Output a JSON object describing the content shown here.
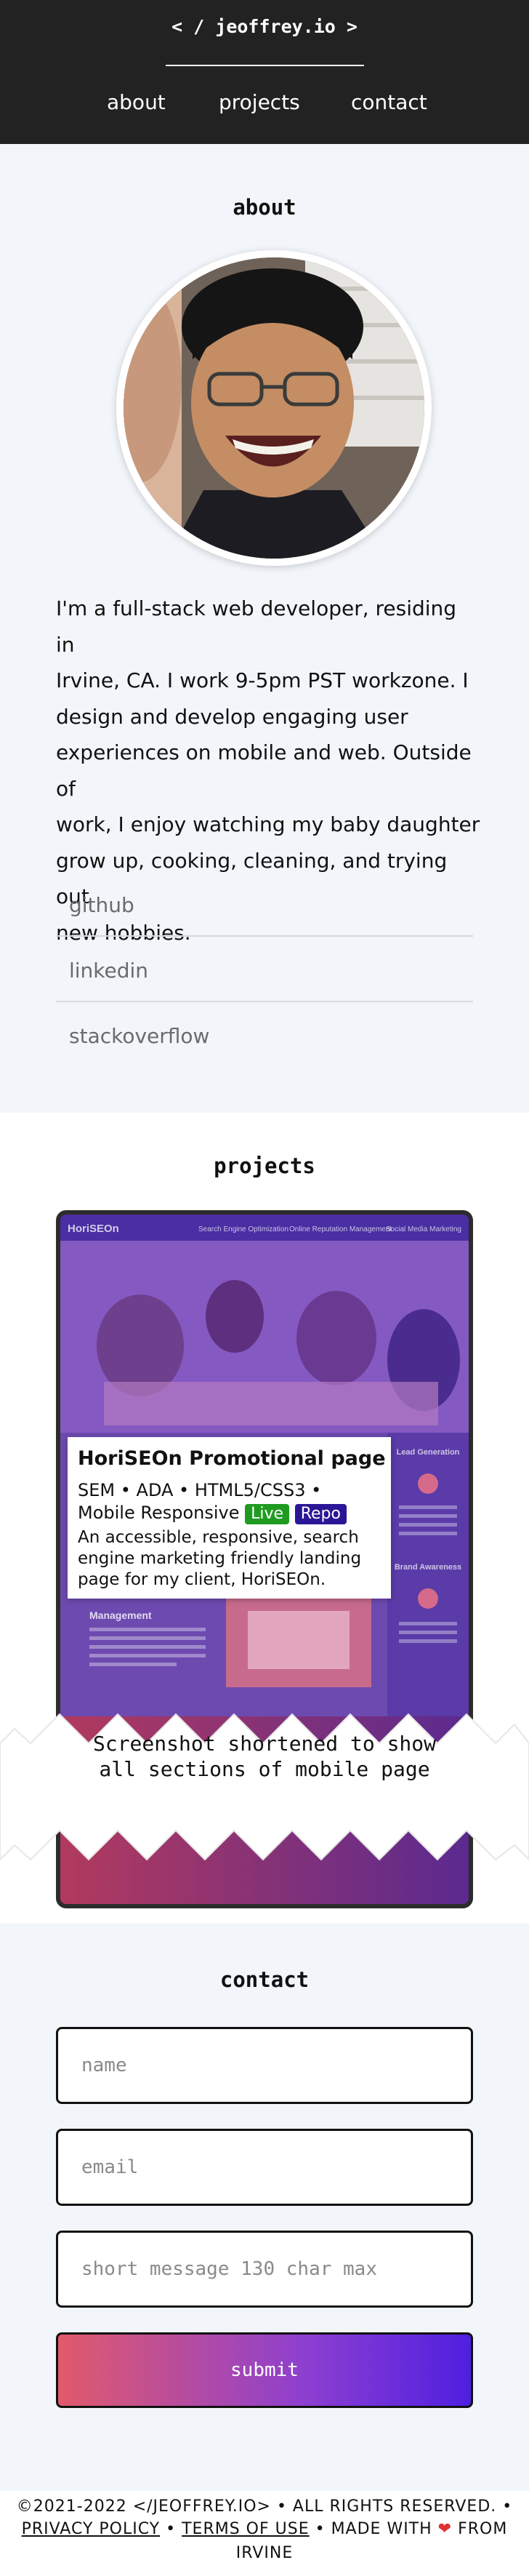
{
  "header": {
    "brand": "< / jeoffrey.io >",
    "nav": [
      {
        "label": "about"
      },
      {
        "label": "projects"
      },
      {
        "label": "contact"
      }
    ]
  },
  "about": {
    "title": "about",
    "bio_lines": [
      "I'm a full-stack web developer, residing in",
      "Irvine, CA. I work 9-5pm PST workzone. I",
      "design and develop engaging user",
      "experiences on mobile and web. Outside of",
      "work, I enjoy watching my baby daughter",
      "grow up, cooking, cleaning, and trying out",
      "new hobbies."
    ],
    "links": [
      {
        "label": "github"
      },
      {
        "label": "linkedin"
      },
      {
        "label": "stackoverflow"
      }
    ]
  },
  "projects": {
    "title": "projects",
    "mockup": {
      "brand": "HoriSEOn",
      "nav": [
        "Search Engine Optimization",
        "Online Reputation Management",
        "Social Media Marketing"
      ],
      "side_1": "Lead Generation",
      "side_2": "Brand Awareness",
      "left_heading": "Management"
    },
    "card": {
      "title": "HoriSEOn Promotional page",
      "tags": "SEM • ADA • HTML5/CSS3 • Mobile Responsive",
      "live_label": "Live",
      "repo_label": "Repo",
      "description": "An accessible, responsive, search engine marketing friendly landing page for my client, HoriSEOn."
    }
  },
  "overlay": {
    "line1": "Screenshot shortened to show",
    "line2": "all sections of mobile page"
  },
  "contact": {
    "title": "contact",
    "name_placeholder": "name",
    "email_placeholder": "email",
    "message_placeholder": "short message 130 char max",
    "submit_label": "submit"
  },
  "footer": {
    "copyright": "©2021-2022 </JEOFFREY.IO> • ALL RIGHTS RESERVED. •",
    "privacy": "PRIVACY POLICY",
    "sep1": "•",
    "terms": "TERMS OF USE",
    "made_with": "• MADE WITH",
    "heart": "❤",
    "from": "FROM",
    "city": "IRVINE"
  },
  "colors": {
    "header_bg": "#222222",
    "page_bg": "#f2f5fa",
    "live_badge": "#1f9b22",
    "repo_badge": "#2b1796",
    "submit_gradient_start": "#e15a6b",
    "submit_gradient_end": "#4f1fe0"
  }
}
